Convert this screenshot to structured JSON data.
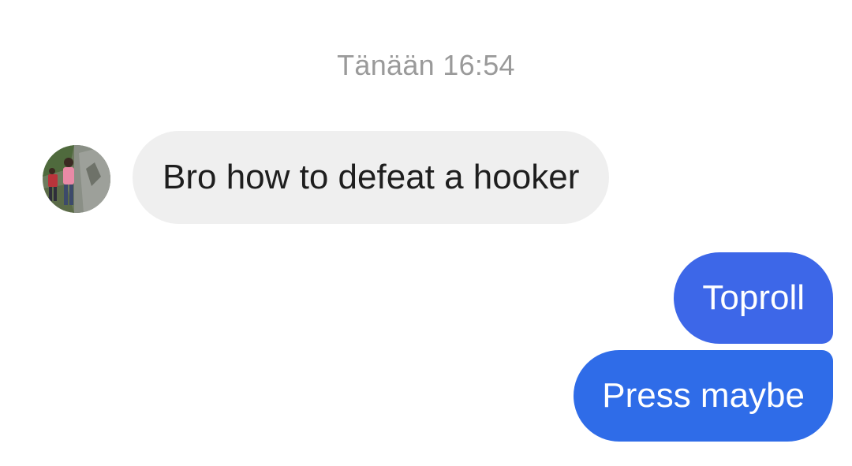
{
  "timestamp": "Tänään 16:54",
  "colors": {
    "incoming_bg": "#efefef",
    "incoming_text": "#1e1e1e",
    "outgoing_bg_top": "#3d67e8",
    "outgoing_bg_bottom": "#2f6ce8",
    "outgoing_text": "#ffffff",
    "timestamp_text": "#9a9a9a"
  },
  "incoming": {
    "avatar_icon": "contact-avatar-photo",
    "messages": [
      {
        "text": "Bro how to defeat a hooker"
      }
    ]
  },
  "outgoing": {
    "messages": [
      {
        "text": "Toproll"
      },
      {
        "text": "Press maybe"
      }
    ]
  }
}
